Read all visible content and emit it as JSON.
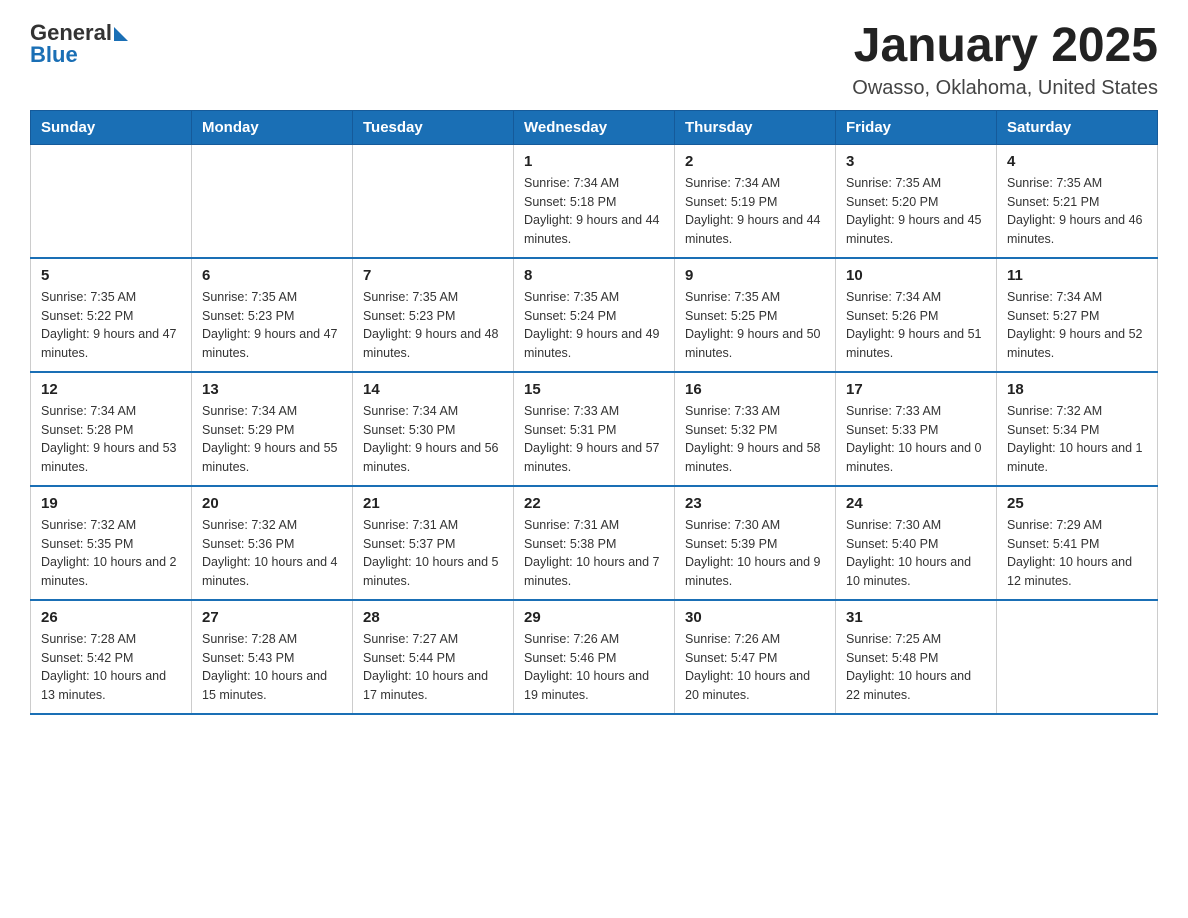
{
  "header": {
    "logo_general": "General",
    "logo_blue": "Blue",
    "title": "January 2025",
    "subtitle": "Owasso, Oklahoma, United States"
  },
  "days_of_week": [
    "Sunday",
    "Monday",
    "Tuesday",
    "Wednesday",
    "Thursday",
    "Friday",
    "Saturday"
  ],
  "weeks": [
    [
      {
        "day": "",
        "sunrise": "",
        "sunset": "",
        "daylight": ""
      },
      {
        "day": "",
        "sunrise": "",
        "sunset": "",
        "daylight": ""
      },
      {
        "day": "",
        "sunrise": "",
        "sunset": "",
        "daylight": ""
      },
      {
        "day": "1",
        "sunrise": "Sunrise: 7:34 AM",
        "sunset": "Sunset: 5:18 PM",
        "daylight": "Daylight: 9 hours and 44 minutes."
      },
      {
        "day": "2",
        "sunrise": "Sunrise: 7:34 AM",
        "sunset": "Sunset: 5:19 PM",
        "daylight": "Daylight: 9 hours and 44 minutes."
      },
      {
        "day": "3",
        "sunrise": "Sunrise: 7:35 AM",
        "sunset": "Sunset: 5:20 PM",
        "daylight": "Daylight: 9 hours and 45 minutes."
      },
      {
        "day": "4",
        "sunrise": "Sunrise: 7:35 AM",
        "sunset": "Sunset: 5:21 PM",
        "daylight": "Daylight: 9 hours and 46 minutes."
      }
    ],
    [
      {
        "day": "5",
        "sunrise": "Sunrise: 7:35 AM",
        "sunset": "Sunset: 5:22 PM",
        "daylight": "Daylight: 9 hours and 47 minutes."
      },
      {
        "day": "6",
        "sunrise": "Sunrise: 7:35 AM",
        "sunset": "Sunset: 5:23 PM",
        "daylight": "Daylight: 9 hours and 47 minutes."
      },
      {
        "day": "7",
        "sunrise": "Sunrise: 7:35 AM",
        "sunset": "Sunset: 5:23 PM",
        "daylight": "Daylight: 9 hours and 48 minutes."
      },
      {
        "day": "8",
        "sunrise": "Sunrise: 7:35 AM",
        "sunset": "Sunset: 5:24 PM",
        "daylight": "Daylight: 9 hours and 49 minutes."
      },
      {
        "day": "9",
        "sunrise": "Sunrise: 7:35 AM",
        "sunset": "Sunset: 5:25 PM",
        "daylight": "Daylight: 9 hours and 50 minutes."
      },
      {
        "day": "10",
        "sunrise": "Sunrise: 7:34 AM",
        "sunset": "Sunset: 5:26 PM",
        "daylight": "Daylight: 9 hours and 51 minutes."
      },
      {
        "day": "11",
        "sunrise": "Sunrise: 7:34 AM",
        "sunset": "Sunset: 5:27 PM",
        "daylight": "Daylight: 9 hours and 52 minutes."
      }
    ],
    [
      {
        "day": "12",
        "sunrise": "Sunrise: 7:34 AM",
        "sunset": "Sunset: 5:28 PM",
        "daylight": "Daylight: 9 hours and 53 minutes."
      },
      {
        "day": "13",
        "sunrise": "Sunrise: 7:34 AM",
        "sunset": "Sunset: 5:29 PM",
        "daylight": "Daylight: 9 hours and 55 minutes."
      },
      {
        "day": "14",
        "sunrise": "Sunrise: 7:34 AM",
        "sunset": "Sunset: 5:30 PM",
        "daylight": "Daylight: 9 hours and 56 minutes."
      },
      {
        "day": "15",
        "sunrise": "Sunrise: 7:33 AM",
        "sunset": "Sunset: 5:31 PM",
        "daylight": "Daylight: 9 hours and 57 minutes."
      },
      {
        "day": "16",
        "sunrise": "Sunrise: 7:33 AM",
        "sunset": "Sunset: 5:32 PM",
        "daylight": "Daylight: 9 hours and 58 minutes."
      },
      {
        "day": "17",
        "sunrise": "Sunrise: 7:33 AM",
        "sunset": "Sunset: 5:33 PM",
        "daylight": "Daylight: 10 hours and 0 minutes."
      },
      {
        "day": "18",
        "sunrise": "Sunrise: 7:32 AM",
        "sunset": "Sunset: 5:34 PM",
        "daylight": "Daylight: 10 hours and 1 minute."
      }
    ],
    [
      {
        "day": "19",
        "sunrise": "Sunrise: 7:32 AM",
        "sunset": "Sunset: 5:35 PM",
        "daylight": "Daylight: 10 hours and 2 minutes."
      },
      {
        "day": "20",
        "sunrise": "Sunrise: 7:32 AM",
        "sunset": "Sunset: 5:36 PM",
        "daylight": "Daylight: 10 hours and 4 minutes."
      },
      {
        "day": "21",
        "sunrise": "Sunrise: 7:31 AM",
        "sunset": "Sunset: 5:37 PM",
        "daylight": "Daylight: 10 hours and 5 minutes."
      },
      {
        "day": "22",
        "sunrise": "Sunrise: 7:31 AM",
        "sunset": "Sunset: 5:38 PM",
        "daylight": "Daylight: 10 hours and 7 minutes."
      },
      {
        "day": "23",
        "sunrise": "Sunrise: 7:30 AM",
        "sunset": "Sunset: 5:39 PM",
        "daylight": "Daylight: 10 hours and 9 minutes."
      },
      {
        "day": "24",
        "sunrise": "Sunrise: 7:30 AM",
        "sunset": "Sunset: 5:40 PM",
        "daylight": "Daylight: 10 hours and 10 minutes."
      },
      {
        "day": "25",
        "sunrise": "Sunrise: 7:29 AM",
        "sunset": "Sunset: 5:41 PM",
        "daylight": "Daylight: 10 hours and 12 minutes."
      }
    ],
    [
      {
        "day": "26",
        "sunrise": "Sunrise: 7:28 AM",
        "sunset": "Sunset: 5:42 PM",
        "daylight": "Daylight: 10 hours and 13 minutes."
      },
      {
        "day": "27",
        "sunrise": "Sunrise: 7:28 AM",
        "sunset": "Sunset: 5:43 PM",
        "daylight": "Daylight: 10 hours and 15 minutes."
      },
      {
        "day": "28",
        "sunrise": "Sunrise: 7:27 AM",
        "sunset": "Sunset: 5:44 PM",
        "daylight": "Daylight: 10 hours and 17 minutes."
      },
      {
        "day": "29",
        "sunrise": "Sunrise: 7:26 AM",
        "sunset": "Sunset: 5:46 PM",
        "daylight": "Daylight: 10 hours and 19 minutes."
      },
      {
        "day": "30",
        "sunrise": "Sunrise: 7:26 AM",
        "sunset": "Sunset: 5:47 PM",
        "daylight": "Daylight: 10 hours and 20 minutes."
      },
      {
        "day": "31",
        "sunrise": "Sunrise: 7:25 AM",
        "sunset": "Sunset: 5:48 PM",
        "daylight": "Daylight: 10 hours and 22 minutes."
      },
      {
        "day": "",
        "sunrise": "",
        "sunset": "",
        "daylight": ""
      }
    ]
  ]
}
